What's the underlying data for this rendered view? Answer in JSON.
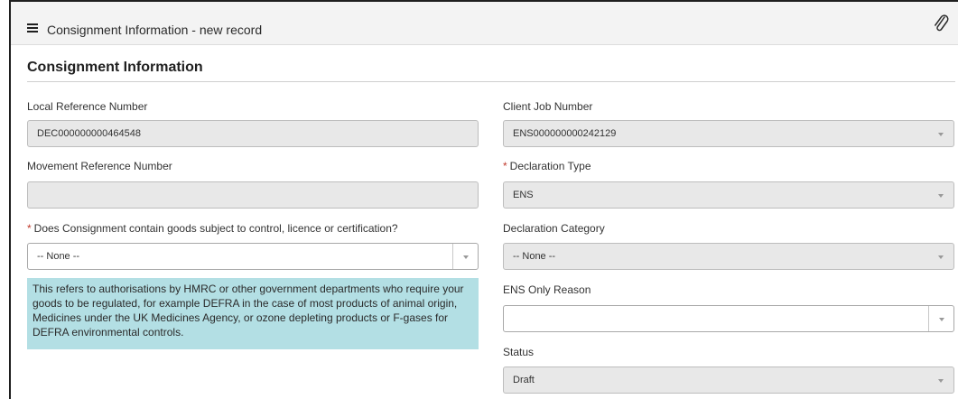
{
  "header": {
    "title": "Consignment Information - new record",
    "menu_icon": "hamburger-menu-icon",
    "attach_icon": "paperclip-icon"
  },
  "section": {
    "title": "Consignment Information"
  },
  "fields": {
    "local_ref": {
      "label": "Local Reference Number",
      "value": "DEC000000000464548"
    },
    "movement_ref": {
      "label": "Movement Reference Number",
      "value": ""
    },
    "controlled_goods": {
      "required": "*",
      "label": "Does Consignment contain goods subject to control, licence or certification?",
      "value": "-- None --"
    },
    "client_job": {
      "label": "Client Job Number",
      "value": "ENS000000000242129"
    },
    "declaration_type": {
      "required": "*",
      "label": "Declaration Type",
      "value": "ENS"
    },
    "declaration_category": {
      "label": "Declaration Category",
      "value": "-- None --"
    },
    "ens_only_reason": {
      "label": "ENS Only Reason",
      "value": ""
    },
    "status": {
      "label": "Status",
      "value": "Draft"
    }
  },
  "info": {
    "text": "This refers to authorisations by HMRC or other government departments who require your goods to be regulated, for example DEFRA in the case of most products of animal origin, Medicines under the UK Medicines Agency, or ozone depleting products or F-gases for DEFRA environmental controls."
  },
  "colors": {
    "info_background": "#b3dfe4",
    "required_marker": "#c0392b",
    "readonly_field": "#e8e8e8",
    "header_background": "#f3f3f3"
  }
}
